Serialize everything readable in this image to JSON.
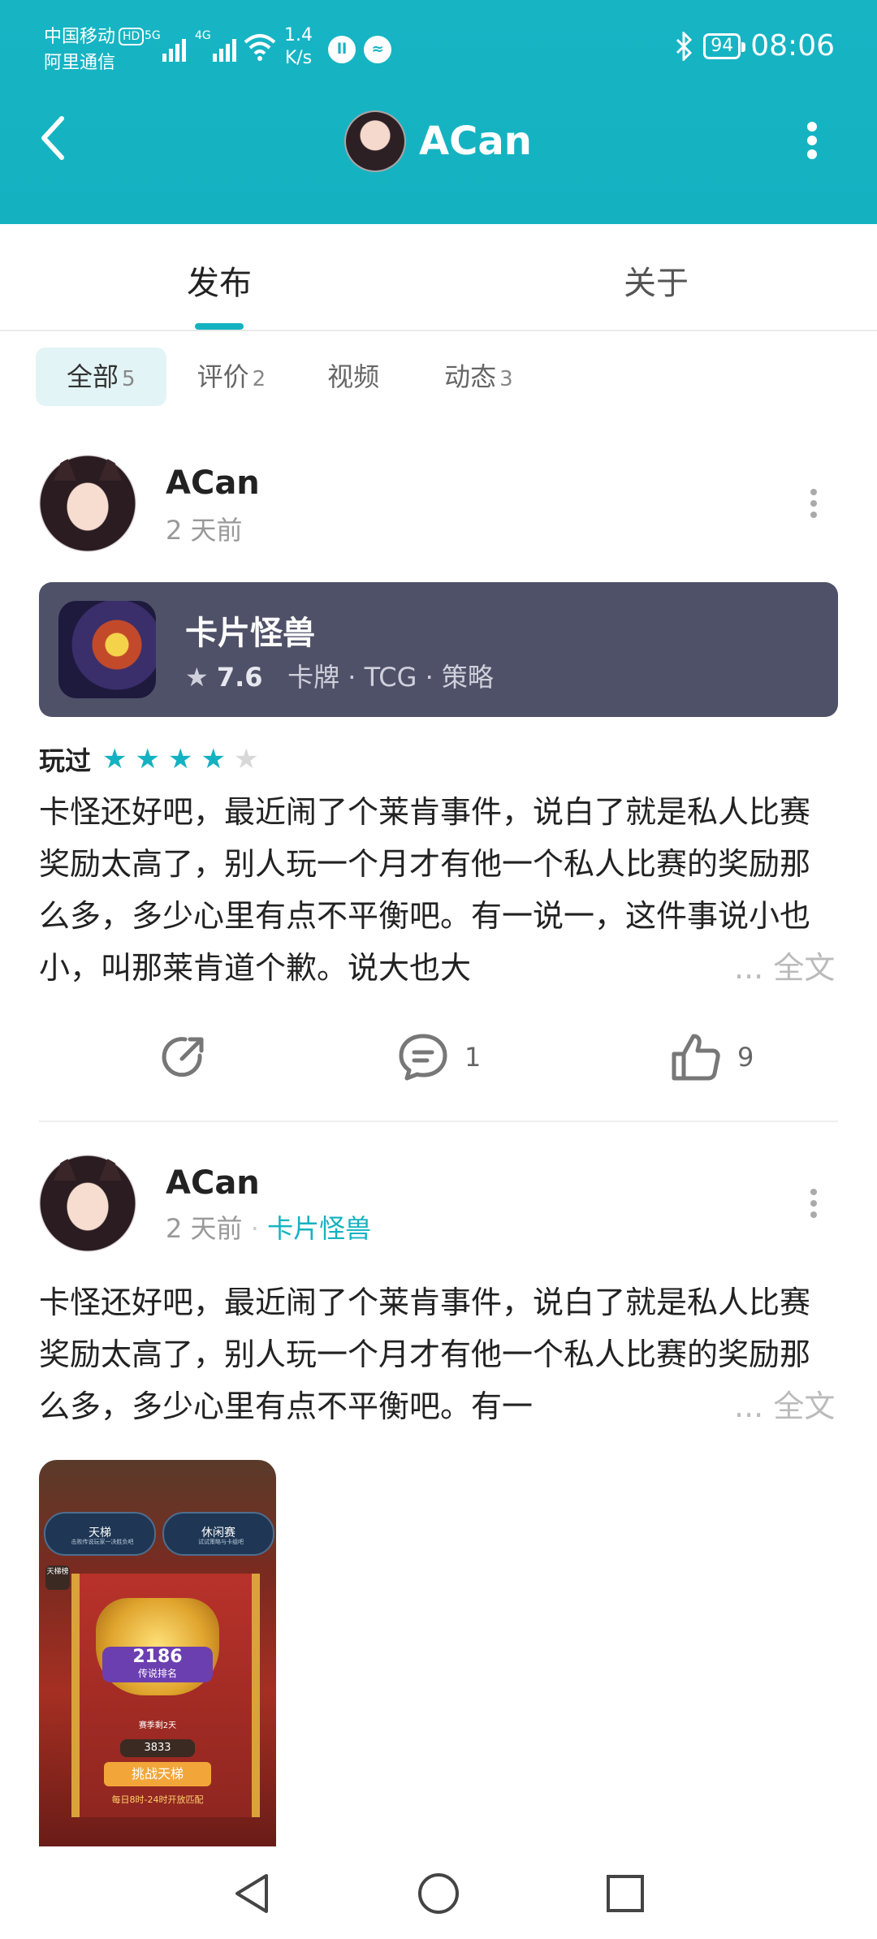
{
  "status": {
    "carrier1": "中国移动",
    "carrier1_badge": "HD",
    "carrier2": "阿里通信",
    "sig1": "5G",
    "sig2": "4G",
    "speed_value": "1.4",
    "speed_unit": "K/s",
    "battery": "94",
    "time": "08:06"
  },
  "header": {
    "title": "ACan"
  },
  "tabs": [
    {
      "label": "发布"
    },
    {
      "label": "关于"
    }
  ],
  "filters": [
    {
      "label": "全部",
      "count": "5"
    },
    {
      "label": "评价",
      "count": "2"
    },
    {
      "label": "视频",
      "count": ""
    },
    {
      "label": "动态",
      "count": "3"
    }
  ],
  "posts": [
    {
      "author": "ACan",
      "time": "2 天前",
      "game": {
        "name": "卡片怪兽",
        "score": "7.6",
        "tags": "卡牌 · TCG · 策略"
      },
      "rating_label": "玩过",
      "stars": 4,
      "text": "卡怪还好吧，最近闹了个莱肯事件，说白了就是私人比赛奖励太高了，别人玩一个月才有他一个私人比赛的奖励那么多，多少心里有点不平衡吧。有一说一，这件事说小也小，叫那莱肯道个歉。说大也大",
      "more": "... 全文",
      "comments": "1",
      "likes": "9"
    },
    {
      "author": "ACan",
      "time": "2 天前",
      "game_tag": "卡片怪兽",
      "text": "卡怪还好吧，最近闹了个莱肯事件，说白了就是私人比赛奖励太高了，别人玩一个月才有他一个私人比赛的奖励那么多，多少心里有点不平衡吧。有一",
      "more": "... 全文",
      "screenshot": {
        "mode1": "天梯",
        "mode1_sub": "击败传说玩家一决胜负吧",
        "mode2": "休闲赛",
        "mode2_sub": "试试策略与卡组吧",
        "side": "天梯榜",
        "rank": "2186",
        "rank_label": "传说排名",
        "season": "赛季剩2天",
        "coins": "3833",
        "button": "挑战天梯",
        "note": "每日8时-24时开放匹配"
      }
    }
  ],
  "icons": {
    "back": "chevron-left-icon",
    "more": "more-vertical-icon",
    "share": "share-icon",
    "comment": "comment-icon",
    "like": "thumbs-up-icon",
    "star": "star-icon",
    "nav_back": "triangle-back-icon",
    "nav_home": "circle-home-icon",
    "nav_recent": "square-recent-icon"
  },
  "colors": {
    "accent": "#14b2c1",
    "card": "#4f5168"
  }
}
